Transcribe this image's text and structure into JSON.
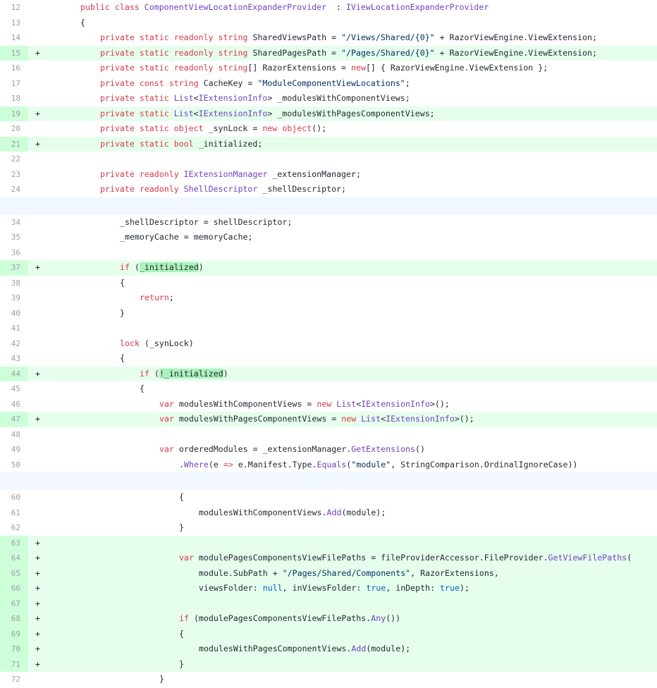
{
  "diff": {
    "lines": [
      {
        "num": "12",
        "type": "context",
        "indent": 7,
        "tokens": [
          [
            "kw",
            "public class "
          ],
          [
            "ty",
            "ComponentViewLocationExpanderProvider"
          ],
          [
            "",
            "  : "
          ],
          [
            "ty",
            "IViewLocationExpanderProvider"
          ]
        ]
      },
      {
        "num": "13",
        "type": "context",
        "indent": 7,
        "tokens": [
          [
            "",
            "{"
          ]
        ]
      },
      {
        "num": "14",
        "type": "context",
        "indent": 11,
        "tokens": [
          [
            "kw",
            "private static readonly string "
          ],
          [
            "",
            "SharedViewsPath = "
          ],
          [
            "st",
            "\"/Views/Shared/{0}\""
          ],
          [
            "",
            " + RazorViewEngine.ViewExtension;"
          ]
        ]
      },
      {
        "num": "15",
        "type": "added",
        "indent": 11,
        "tokens": [
          [
            "kw",
            "private static readonly string "
          ],
          [
            "",
            "SharedPagesPath = "
          ],
          [
            "st",
            "\"/Pages/Shared/{0}\""
          ],
          [
            "",
            " + RazorViewEngine.ViewExtension;"
          ]
        ]
      },
      {
        "num": "16",
        "type": "context",
        "indent": 11,
        "tokens": [
          [
            "kw",
            "private static readonly string"
          ],
          [
            "",
            "[] RazorExtensions = "
          ],
          [
            "kw",
            "new"
          ],
          [
            "",
            "[] { RazorViewEngine.ViewExtension };"
          ]
        ]
      },
      {
        "num": "17",
        "type": "context",
        "indent": 11,
        "tokens": [
          [
            "kw",
            "private const string "
          ],
          [
            "",
            "CacheKey = "
          ],
          [
            "st",
            "\"ModuleComponentViewLocations\""
          ],
          [
            "",
            ";"
          ]
        ]
      },
      {
        "num": "18",
        "type": "context",
        "indent": 11,
        "tokens": [
          [
            "kw",
            "private static "
          ],
          [
            "ty",
            "List"
          ],
          [
            "",
            "<"
          ],
          [
            "ty",
            "IExtensionInfo"
          ],
          [
            "",
            "> _modulesWithComponentViews;"
          ]
        ]
      },
      {
        "num": "19",
        "type": "added",
        "indent": 11,
        "tokens": [
          [
            "kw",
            "private static "
          ],
          [
            "ty",
            "List"
          ],
          [
            "",
            "<"
          ],
          [
            "ty",
            "IExtensionInfo"
          ],
          [
            "",
            "> _modulesWithPagesComponentViews;"
          ]
        ]
      },
      {
        "num": "20",
        "type": "context",
        "indent": 11,
        "tokens": [
          [
            "kw",
            "private static object "
          ],
          [
            "",
            "_synLock = "
          ],
          [
            "kw",
            "new object"
          ],
          [
            "",
            "();"
          ]
        ]
      },
      {
        "num": "21",
        "type": "added",
        "indent": 11,
        "tokens": [
          [
            "kw",
            "private static bool "
          ],
          [
            "",
            "_initialized;"
          ]
        ]
      },
      {
        "num": "22",
        "type": "context",
        "indent": 0,
        "tokens": []
      },
      {
        "num": "23",
        "type": "context",
        "indent": 11,
        "tokens": [
          [
            "kw",
            "private readonly "
          ],
          [
            "ty",
            "IExtensionManager"
          ],
          [
            "",
            " _extensionManager;"
          ]
        ]
      },
      {
        "num": "24",
        "type": "context",
        "indent": 11,
        "tokens": [
          [
            "kw",
            "private readonly "
          ],
          [
            "ty",
            "ShellDescriptor"
          ],
          [
            "",
            " _shellDescriptor;"
          ]
        ]
      },
      {
        "num": "",
        "type": "hunk",
        "indent": 0,
        "tokens": []
      },
      {
        "num": "34",
        "type": "context",
        "indent": 15,
        "tokens": [
          [
            "",
            "_shellDescriptor = shellDescriptor;"
          ]
        ]
      },
      {
        "num": "35",
        "type": "context",
        "indent": 15,
        "tokens": [
          [
            "",
            "_memoryCache = memoryCache;"
          ]
        ]
      },
      {
        "num": "36",
        "type": "context",
        "indent": 0,
        "tokens": []
      },
      {
        "num": "37",
        "type": "added",
        "indent": 15,
        "tokens": [
          [
            "kw",
            "if"
          ],
          [
            "",
            " ("
          ],
          [
            "hl",
            "_initialized"
          ],
          [
            "",
            ")"
          ]
        ]
      },
      {
        "num": "38",
        "type": "context",
        "indent": 15,
        "tokens": [
          [
            "",
            "{"
          ]
        ]
      },
      {
        "num": "39",
        "type": "context",
        "indent": 19,
        "tokens": [
          [
            "kw",
            "return"
          ],
          [
            "",
            ";"
          ]
        ]
      },
      {
        "num": "40",
        "type": "context",
        "indent": 15,
        "tokens": [
          [
            "",
            "}"
          ]
        ]
      },
      {
        "num": "41",
        "type": "context",
        "indent": 0,
        "tokens": []
      },
      {
        "num": "42",
        "type": "context",
        "indent": 15,
        "tokens": [
          [
            "kw",
            "lock"
          ],
          [
            "",
            " (_synLock)"
          ]
        ]
      },
      {
        "num": "43",
        "type": "context",
        "indent": 15,
        "tokens": [
          [
            "",
            "{"
          ]
        ]
      },
      {
        "num": "44",
        "type": "added",
        "indent": 19,
        "tokens": [
          [
            "kw",
            "if"
          ],
          [
            "",
            " ("
          ],
          [
            "hl",
            "!_initialized"
          ],
          [
            "",
            ")"
          ]
        ]
      },
      {
        "num": "45",
        "type": "context",
        "indent": 19,
        "tokens": [
          [
            "",
            "{"
          ]
        ]
      },
      {
        "num": "46",
        "type": "context",
        "indent": 23,
        "tokens": [
          [
            "kw",
            "var "
          ],
          [
            "",
            "modulesWithComponentViews = "
          ],
          [
            "kw",
            "new "
          ],
          [
            "ty",
            "List"
          ],
          [
            "",
            "<"
          ],
          [
            "ty",
            "IExtensionInfo"
          ],
          [
            "",
            ">();"
          ]
        ]
      },
      {
        "num": "47",
        "type": "added",
        "indent": 23,
        "tokens": [
          [
            "kw",
            "var "
          ],
          [
            "",
            "modulesWithPagesComponentViews = "
          ],
          [
            "kw",
            "new "
          ],
          [
            "ty",
            "List"
          ],
          [
            "",
            "<"
          ],
          [
            "ty",
            "IExtensionInfo"
          ],
          [
            "",
            ">();"
          ]
        ]
      },
      {
        "num": "48",
        "type": "context",
        "indent": 0,
        "tokens": []
      },
      {
        "num": "49",
        "type": "context",
        "indent": 23,
        "tokens": [
          [
            "kw",
            "var "
          ],
          [
            "",
            "orderedModules = _extensionManager."
          ],
          [
            "ty",
            "GetExtensions"
          ],
          [
            "",
            "()"
          ]
        ]
      },
      {
        "num": "50",
        "type": "context",
        "indent": 27,
        "tokens": [
          [
            "",
            "."
          ],
          [
            "ty",
            "Where"
          ],
          [
            "",
            "(e "
          ],
          [
            "kw",
            "=>"
          ],
          [
            "",
            " e.Manifest.Type."
          ],
          [
            "ty",
            "Equals"
          ],
          [
            "",
            "("
          ],
          [
            "st",
            "\"module\""
          ],
          [
            "",
            ", StringComparison.OrdinalIgnoreCase))"
          ]
        ]
      },
      {
        "num": "",
        "type": "hunk",
        "indent": 0,
        "tokens": []
      },
      {
        "num": "60",
        "type": "context",
        "indent": 27,
        "tokens": [
          [
            "",
            "{"
          ]
        ]
      },
      {
        "num": "61",
        "type": "context",
        "indent": 31,
        "tokens": [
          [
            "",
            "modulesWithComponentViews."
          ],
          [
            "ty",
            "Add"
          ],
          [
            "",
            "(module);"
          ]
        ]
      },
      {
        "num": "62",
        "type": "context",
        "indent": 27,
        "tokens": [
          [
            "",
            "}"
          ]
        ]
      },
      {
        "num": "63",
        "type": "added",
        "indent": 0,
        "tokens": []
      },
      {
        "num": "64",
        "type": "added",
        "indent": 27,
        "tokens": [
          [
            "kw",
            "var "
          ],
          [
            "",
            "modulePagesComponentsViewFilePaths = fileProviderAccessor.FileProvider."
          ],
          [
            "ty",
            "GetViewFilePaths"
          ],
          [
            "",
            "("
          ]
        ]
      },
      {
        "num": "65",
        "type": "added",
        "indent": 31,
        "tokens": [
          [
            "",
            "module.SubPath + "
          ],
          [
            "st",
            "\"/Pages/Shared/Components\""
          ],
          [
            "",
            ", RazorExtensions,"
          ]
        ]
      },
      {
        "num": "66",
        "type": "added",
        "indent": 31,
        "tokens": [
          [
            "",
            "viewsFolder: "
          ],
          [
            "bo",
            "null"
          ],
          [
            "",
            ", inViewsFolder: "
          ],
          [
            "bo",
            "true"
          ],
          [
            "",
            ", inDepth: "
          ],
          [
            "bo",
            "true"
          ],
          [
            "",
            ");"
          ]
        ]
      },
      {
        "num": "67",
        "type": "added",
        "indent": 0,
        "tokens": []
      },
      {
        "num": "68",
        "type": "added",
        "indent": 27,
        "tokens": [
          [
            "kw",
            "if"
          ],
          [
            "",
            " (modulePagesComponentsViewFilePaths."
          ],
          [
            "ty",
            "Any"
          ],
          [
            "",
            "())"
          ]
        ]
      },
      {
        "num": "69",
        "type": "added",
        "indent": 27,
        "tokens": [
          [
            "",
            "{"
          ]
        ]
      },
      {
        "num": "70",
        "type": "added",
        "indent": 31,
        "tokens": [
          [
            "",
            "modulesWithPagesComponentViews."
          ],
          [
            "ty",
            "Add"
          ],
          [
            "",
            "(module);"
          ]
        ]
      },
      {
        "num": "71",
        "type": "added",
        "indent": 27,
        "tokens": [
          [
            "",
            "}"
          ]
        ]
      },
      {
        "num": "72",
        "type": "context",
        "indent": 23,
        "tokens": [
          [
            "",
            "}"
          ]
        ]
      }
    ]
  }
}
